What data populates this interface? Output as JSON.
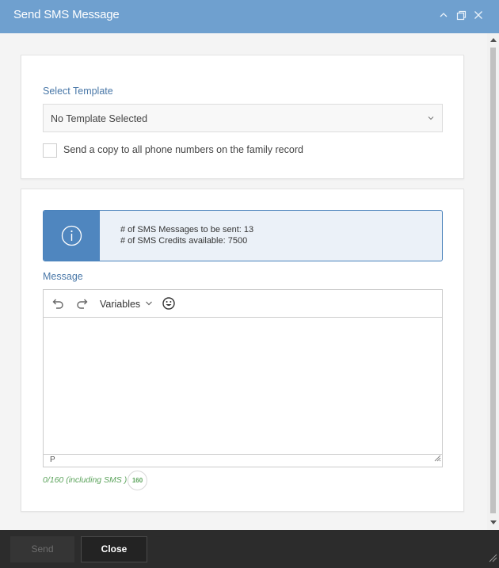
{
  "window": {
    "title": "Send SMS Message",
    "accent_color": "#6fa0cf",
    "controls": [
      "minimize-icon",
      "maximize-icon",
      "close-icon"
    ]
  },
  "template_section": {
    "label": "Select Template",
    "selected": "No Template Selected",
    "copy_checkbox_label": "Send a copy to all phone numbers on the family record",
    "copy_checked": false
  },
  "info_box": {
    "icon": "info-icon",
    "messages_line": "# of SMS Messages to be sent: 13",
    "credits_line": "# of SMS Credits available: 7500"
  },
  "message": {
    "label": "Message",
    "toolbar": {
      "undo": "undo-icon",
      "redo": "redo-icon",
      "variables_label": "Variables",
      "emoji": "emoji-icon"
    },
    "body": "",
    "status_path": "P",
    "counter_text": "0/160 (including SMS )",
    "remaining_badge": "160",
    "counter_color": "#5ba35b"
  },
  "footer": {
    "send_label": "Send",
    "close_label": "Close"
  }
}
